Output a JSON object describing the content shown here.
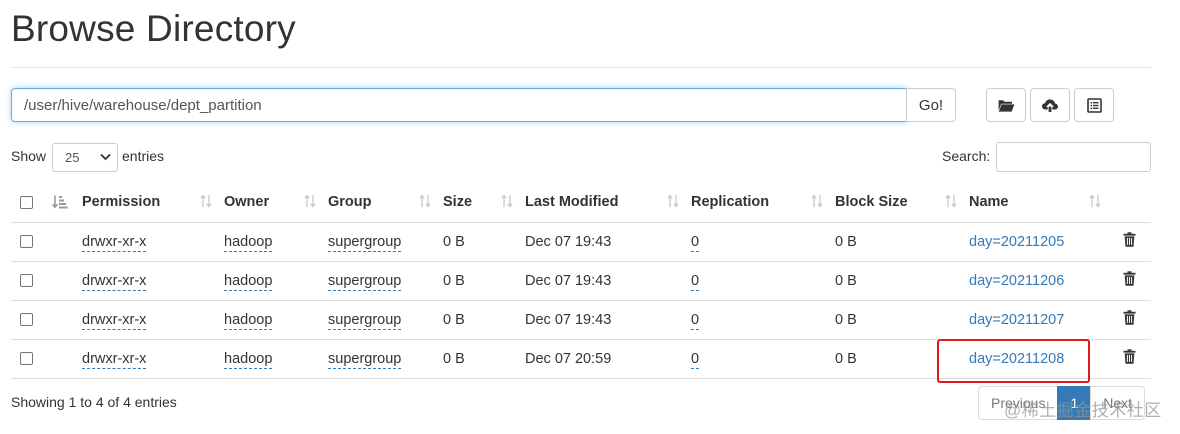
{
  "page": {
    "title": "Browse Directory"
  },
  "path_bar": {
    "value": "/user/hive/warehouse/dept_partition",
    "go_label": "Go!"
  },
  "length_menu": {
    "show_label": "Show",
    "selected": "25",
    "entries_label": "entries"
  },
  "search": {
    "label": "Search:",
    "value": ""
  },
  "table": {
    "columns": [
      "Permission",
      "Owner",
      "Group",
      "Size",
      "Last Modified",
      "Replication",
      "Block Size",
      "Name"
    ],
    "rows": [
      {
        "permission": "drwxr-xr-x",
        "owner": "hadoop",
        "group": "supergroup",
        "size": "0 B",
        "last_modified": "Dec 07 19:43",
        "replication": "0",
        "block_size": "0 B",
        "name": "day=20211205"
      },
      {
        "permission": "drwxr-xr-x",
        "owner": "hadoop",
        "group": "supergroup",
        "size": "0 B",
        "last_modified": "Dec 07 19:43",
        "replication": "0",
        "block_size": "0 B",
        "name": "day=20211206"
      },
      {
        "permission": "drwxr-xr-x",
        "owner": "hadoop",
        "group": "supergroup",
        "size": "0 B",
        "last_modified": "Dec 07 19:43",
        "replication": "0",
        "block_size": "0 B",
        "name": "day=20211207"
      },
      {
        "permission": "drwxr-xr-x",
        "owner": "hadoop",
        "group": "supergroup",
        "size": "0 B",
        "last_modified": "Dec 07 20:59",
        "replication": "0",
        "block_size": "0 B",
        "name": "day=20211208"
      }
    ]
  },
  "footer": {
    "info": "Showing 1 to 4 of 4 entries",
    "previous_label": "Previous",
    "current_page": "1",
    "next_label": "Next"
  },
  "watermark": "@稀土掘金技术社区",
  "icons": {
    "toolbar": [
      "folder-open-icon",
      "cloud-upload-icon",
      "list-alt-icon"
    ],
    "row_action": "trash-icon",
    "sort": "sort-arrows-icon"
  },
  "colors": {
    "link": "#337ab7",
    "active_page": "#337ab7",
    "highlight": "#e0191b",
    "focus_border": "#66afe9"
  }
}
